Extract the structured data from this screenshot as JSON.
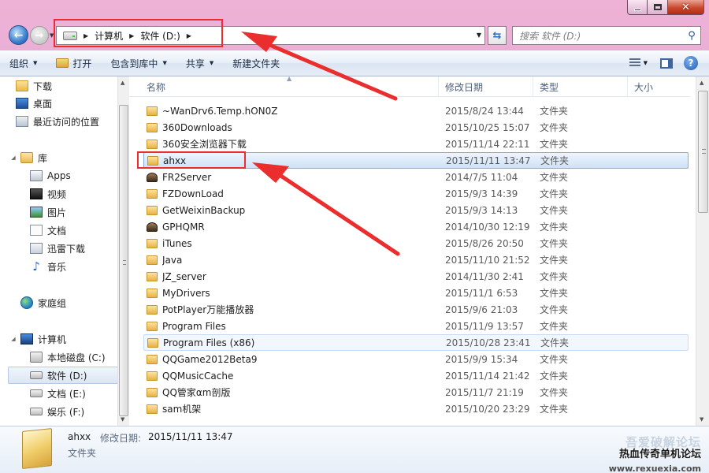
{
  "address": {
    "crumbs": [
      "计算机",
      "软件 (D:)"
    ]
  },
  "search": {
    "placeholder": "搜索 软件 (D:)"
  },
  "toolbar": {
    "organize": "组织",
    "open": "打开",
    "include_library": "包含到库中",
    "share": "共享",
    "new_folder": "新建文件夹"
  },
  "navpane": {
    "favorites": [
      "下载",
      "桌面",
      "最近访问的位置"
    ],
    "library_header": "库",
    "libraries": [
      "Apps",
      "视频",
      "图片",
      "文档",
      "迅雷下载",
      "音乐"
    ],
    "homegroup": "家庭组",
    "computer": "计算机",
    "drives": [
      "本地磁盘 (C:)",
      "软件 (D:)",
      "文档 (E:)",
      "娱乐 (F:)"
    ]
  },
  "columns": {
    "name": "名称",
    "date": "修改日期",
    "type": "类型",
    "size": "大小"
  },
  "files": [
    {
      "name": "~WanDrv6.Temp.hON0Z",
      "date": "2015/8/24 13:44",
      "type": "文件夹",
      "icon": "folder-icon"
    },
    {
      "name": "360Downloads",
      "date": "2015/10/25 15:07",
      "type": "文件夹",
      "icon": "folder-icon"
    },
    {
      "name": "360安全浏览器下载",
      "date": "2015/11/14 22:11",
      "type": "文件夹",
      "icon": "folder-icon"
    },
    {
      "name": "ahxx",
      "date": "2015/11/11 13:47",
      "type": "文件夹",
      "icon": "folder-icon"
    },
    {
      "name": "FR2Server",
      "date": "2014/7/5 11:04",
      "type": "文件夹",
      "icon": "user-folder-icon"
    },
    {
      "name": "FZDownLoad",
      "date": "2015/9/3 14:39",
      "type": "文件夹",
      "icon": "folder-icon"
    },
    {
      "name": "GetWeixinBackup",
      "date": "2015/9/3 14:13",
      "type": "文件夹",
      "icon": "folder-icon"
    },
    {
      "name": "GPHQMR",
      "date": "2014/10/30 12:19",
      "type": "文件夹",
      "icon": "user-folder-icon"
    },
    {
      "name": "iTunes",
      "date": "2015/8/26 20:50",
      "type": "文件夹",
      "icon": "folder-icon"
    },
    {
      "name": "Java",
      "date": "2015/11/10 21:52",
      "type": "文件夹",
      "icon": "folder-icon"
    },
    {
      "name": "JZ_server",
      "date": "2014/11/30 2:41",
      "type": "文件夹",
      "icon": "folder-icon"
    },
    {
      "name": "MyDrivers",
      "date": "2015/11/1 6:53",
      "type": "文件夹",
      "icon": "folder-icon"
    },
    {
      "name": "PotPlayer万能播放器",
      "date": "2015/9/6 21:03",
      "type": "文件夹",
      "icon": "folder-icon"
    },
    {
      "name": "Program Files",
      "date": "2015/11/9 13:57",
      "type": "文件夹",
      "icon": "folder-icon"
    },
    {
      "name": "Program Files (x86)",
      "date": "2015/10/28 23:41",
      "type": "文件夹",
      "icon": "folder-icon"
    },
    {
      "name": "QQGame2012Beta9",
      "date": "2015/9/9 15:34",
      "type": "文件夹",
      "icon": "folder-icon"
    },
    {
      "name": "QQMusicCache",
      "date": "2015/11/14 21:42",
      "type": "文件夹",
      "icon": "folder-icon"
    },
    {
      "name": "QQ管家αm剖版",
      "date": "2015/11/7 21:19",
      "type": "文件夹",
      "icon": "folder-icon"
    },
    {
      "name": "sam机架",
      "date": "2015/10/20 23:29",
      "type": "文件夹",
      "icon": "folder-icon"
    }
  ],
  "details": {
    "name": "ahxx",
    "date_label": "修改日期:",
    "date": "2015/11/11 13:47",
    "type": "文件夹"
  },
  "watermark": {
    "title": "吾爱破解论坛",
    "overlay": "热血传奇单机论坛",
    "url": "www.rexuexia.com"
  },
  "colors": {
    "annotation": "#ea2d2d",
    "selection": "#cfe2f8"
  }
}
